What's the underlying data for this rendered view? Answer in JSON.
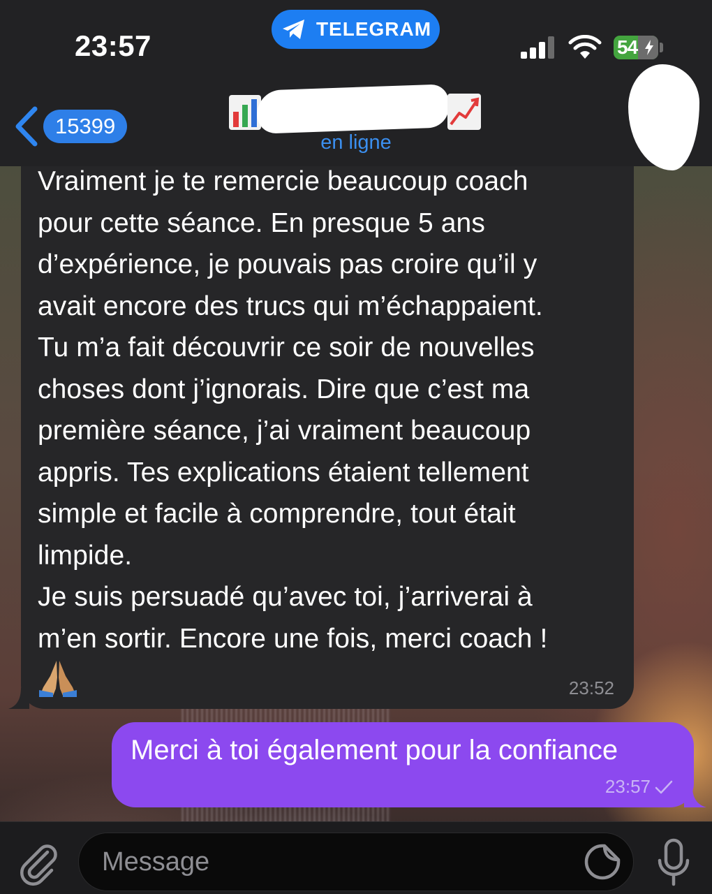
{
  "status_bar": {
    "time": "23:57",
    "app_pill": "TELEGRAM",
    "battery_level": "54"
  },
  "header": {
    "back_count": "15399",
    "status": "en ligne"
  },
  "messages": [
    {
      "direction": "incoming",
      "text": "Vraiment je te remercie beaucoup coach\npour cette séance. En presque 5 ans\nd’expérience, je pouvais pas croire qu’il y\navait encore des trucs qui m’échappaient.\nTu m’a fait découvrir ce soir de nouvelles\nchoses dont j’ignorais. Dire que c’est ma\npremière séance, j’ai vraiment beaucoup\nappris. Tes explications étaient tellement\nsimple et facile à comprendre, tout était\nlimpide.\nJe suis persuadé qu’avec toi, j’arriverai à\nm’en sortir. Encore une fois, merci coach !",
      "emoji": "folded-hands",
      "time": "23:52"
    },
    {
      "direction": "outgoing",
      "text": "Merci à toi également pour la confiance",
      "time": "23:57",
      "read_status": "check-icon"
    }
  ],
  "composer": {
    "placeholder": "Message"
  },
  "colors": {
    "accent_blue": "#1d7ef2",
    "outgoing_bubble": "#8c49ef",
    "incoming_bubble": "#262628"
  }
}
